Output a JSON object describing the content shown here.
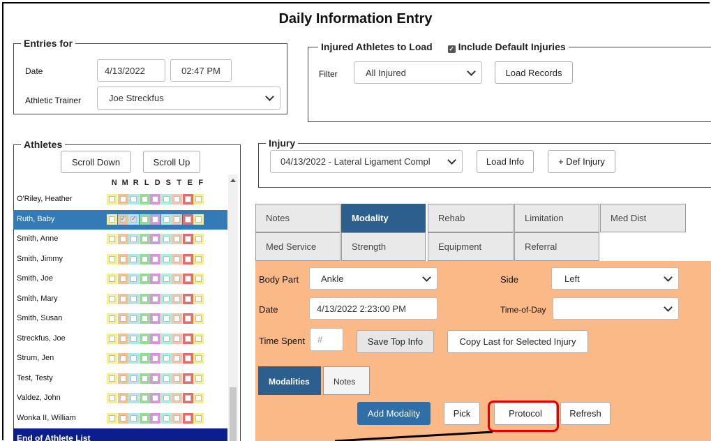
{
  "page_title": "Daily Information Entry",
  "entries": {
    "legend": "Entries for",
    "date_label": "Date",
    "date_value": "4/13/2022",
    "time_value": "02:47 PM",
    "trainer_label": "Athletic Trainer",
    "trainer_value": "Joe Streckfus"
  },
  "injured": {
    "legend": "Injured Athletes to Load",
    "include_default_label": "Include Default Injuries",
    "include_default_checked": true,
    "filter_label": "Filter",
    "filter_value": "All Injured",
    "load_button": "Load Records"
  },
  "athletes": {
    "legend": "Athletes",
    "scroll_down": "Scroll Down",
    "scroll_up": "Scroll Up",
    "column_letters": [
      "N",
      "M",
      "R",
      "L",
      "D",
      "S",
      "T",
      "E",
      "F"
    ],
    "column_colors": [
      "#f3f18a",
      "#f5c08a",
      "#aee8ee",
      "#8fe08f",
      "#d992e0",
      "#a8f0e0",
      "#f2c6a8",
      "#e86a6a",
      "#f3f18a"
    ],
    "rows": [
      {
        "name": "O'Riley, Heather"
      },
      {
        "name": "Ruth, Baby",
        "selected": true
      },
      {
        "name": "Smith, Anne"
      },
      {
        "name": "Smith, Jimmy"
      },
      {
        "name": "Smith, Joe"
      },
      {
        "name": "Smith, Mary"
      },
      {
        "name": "Smith, Susan"
      },
      {
        "name": "Streckfus, Joe"
      },
      {
        "name": "Strum, Jen"
      },
      {
        "name": "Test, Testy"
      },
      {
        "name": "Valdez, John"
      },
      {
        "name": "Wonka II, William"
      }
    ],
    "end_label": "End of Athlete List"
  },
  "injury": {
    "legend": "Injury",
    "selected": "04/13/2022 - Lateral Ligament Compl",
    "load_info": "Load Info",
    "def_injury": "+ Def Injury"
  },
  "tabs": {
    "row1": [
      "Notes",
      "Modality",
      "Rehab",
      "Limitation",
      "Med Dist"
    ],
    "row2": [
      "Med Service",
      "Strength",
      "Equipment",
      "Referral"
    ],
    "active": "Modality"
  },
  "form": {
    "body_part_label": "Body Part",
    "body_part_value": "Ankle",
    "side_label": "Side",
    "side_value": "Left",
    "date_label": "Date",
    "date_value": "4/13/2022 2:23:00 PM",
    "tod_label": "Time-of-Day",
    "tod_value": "",
    "time_spent_label": "Time Spent",
    "time_spent_placeholder": "#",
    "save_top": "Save Top Info",
    "copy_last": "Copy Last for Selected Injury"
  },
  "subtabs": {
    "modalities": "Modalities",
    "notes": "Notes"
  },
  "actions": {
    "add": "Add Modality",
    "pick": "Pick",
    "protocol": "Protocol",
    "refresh": "Refresh",
    "highlight_color": "#e00000"
  }
}
